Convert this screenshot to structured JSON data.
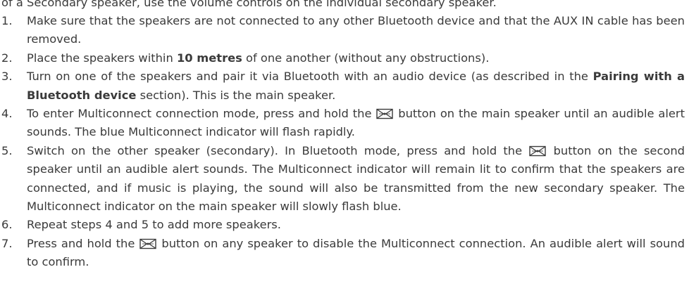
{
  "intro_line": "of a Secondary speaker, use the volume controls on the individual secondary speaker.",
  "steps": [
    {
      "number": "1.",
      "parts": [
        "Make sure that the speakers are not connected to any other Bluetooth device and that the AUX IN cable has been removed."
      ]
    },
    {
      "number": "2.",
      "parts": [
        "Place the speakers within ",
        "10 metres",
        " of one another (without any obstructions)."
      ]
    },
    {
      "number": "3.",
      "parts": [
        "Turn on one of the speakers and pair it via Bluetooth with an audio device (as described in the ",
        "Pairing with a Bluetooth device",
        " section). This is the main speaker."
      ]
    },
    {
      "number": "4.",
      "parts": [
        "To enter Multiconnect connection mode, press and hold the ",
        " button on the main speaker until an audible alert sounds. The blue Multiconnect indicator will flash rapidly."
      ]
    },
    {
      "number": "5.",
      "parts": [
        "Switch on the other speaker (secondary). In Bluetooth mode, press and hold the ",
        " button on the second speaker until an audible alert sounds. The Multiconnect indicator will remain lit to confirm that the speakers are connected, and if music is playing, the sound will also be transmitted from the new secondary speaker. The Multiconnect indicator on the main speaker will slowly flash blue."
      ]
    },
    {
      "number": "6.",
      "parts": [
        "Repeat steps 4 and 5 to add more speakers."
      ]
    },
    {
      "number": "7.",
      "parts": [
        "Press and hold the ",
        " button on any speaker to disable the Multiconnect connection. An audible alert will sound to confirm."
      ]
    }
  ],
  "icons": {
    "multiconnect": "multiconnect-icon"
  },
  "colors": {
    "text": "#3a3a3a",
    "background": "#ffffff"
  }
}
